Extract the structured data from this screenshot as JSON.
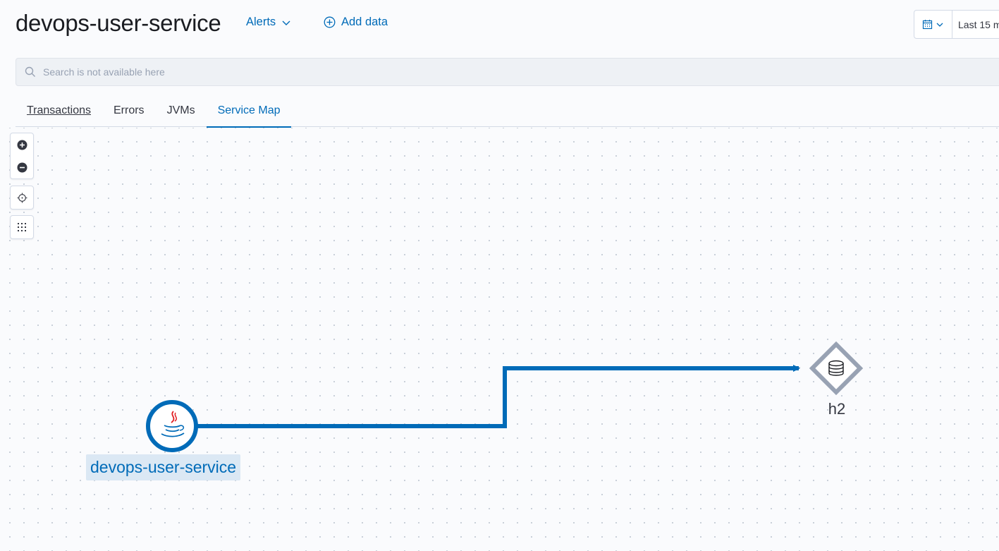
{
  "header": {
    "title": "devops-user-service",
    "alerts_label": "Alerts",
    "add_data_label": "Add data"
  },
  "datepicker": {
    "range_text": "Last 15 m"
  },
  "search": {
    "placeholder": "Search is not available here"
  },
  "tabs": [
    {
      "label": "Transactions"
    },
    {
      "label": "Errors"
    },
    {
      "label": "JVMs"
    },
    {
      "label": "Service Map",
      "active": true
    }
  ],
  "service_map": {
    "service_node": {
      "label": "devops-user-service",
      "icon": "java-icon"
    },
    "db_node": {
      "label": "h2",
      "icon": "database-icon"
    },
    "edge_color": "#006bb8"
  },
  "colors": {
    "accent": "#006bb8",
    "node_gray": "#98a2b3"
  }
}
